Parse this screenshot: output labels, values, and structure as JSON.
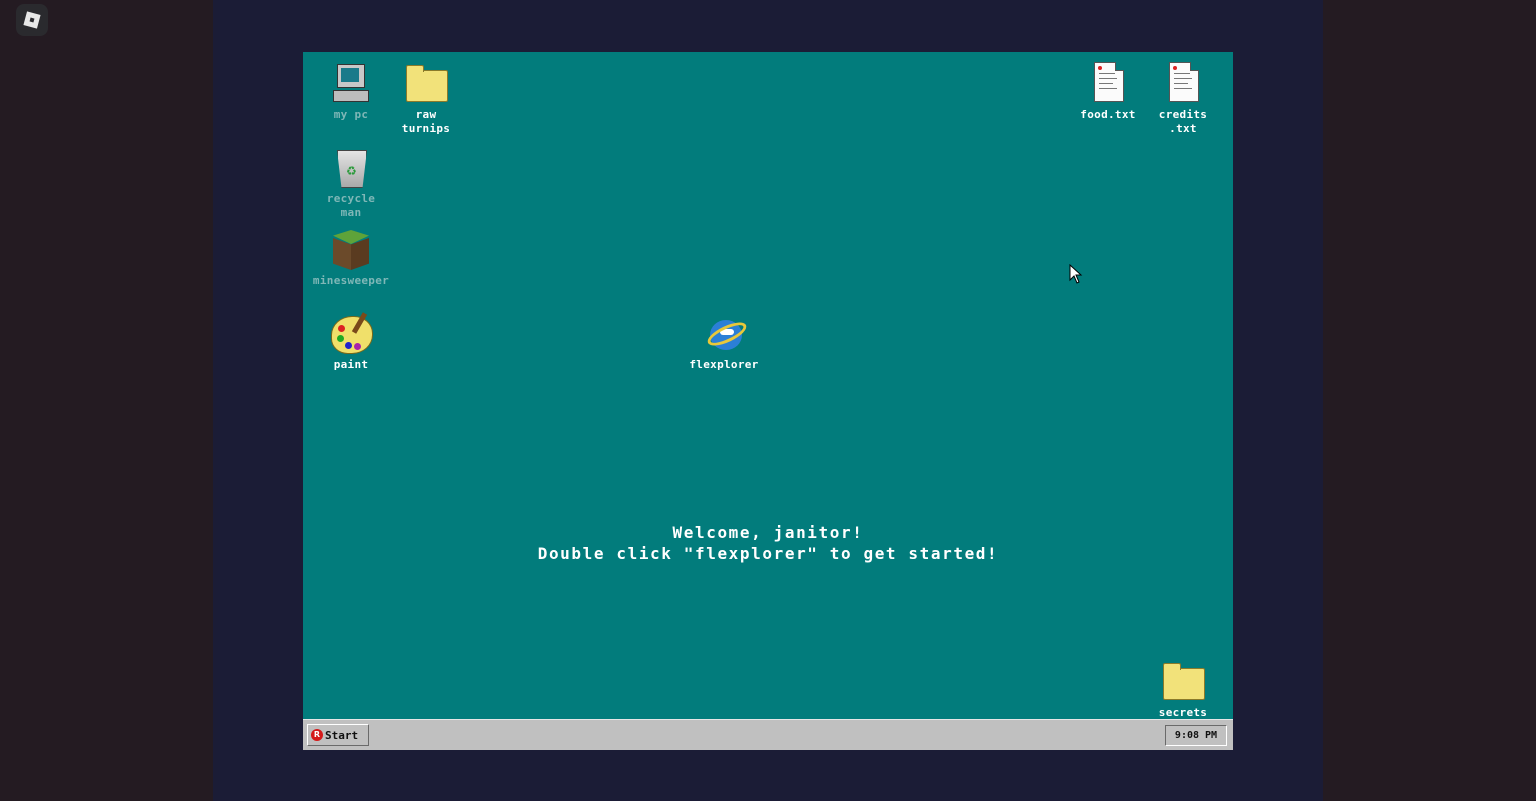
{
  "desktop": {
    "icons": [
      {
        "id": "my-pc",
        "label": "my pc",
        "icon": "computer-icon"
      },
      {
        "id": "raw-turnips",
        "label": "raw\nturnips",
        "icon": "folder-icon"
      },
      {
        "id": "recycle-man",
        "label": "recycle\nman",
        "icon": "recycle-bin-icon"
      },
      {
        "id": "minesweeper",
        "label": "minesweeper",
        "icon": "grass-block-icon"
      },
      {
        "id": "paint",
        "label": "paint",
        "icon": "palette-icon"
      },
      {
        "id": "flexplorer",
        "label": "flexplorer",
        "icon": "browser-icon"
      },
      {
        "id": "food-txt",
        "label": "food.txt",
        "icon": "text-file-icon"
      },
      {
        "id": "credits-txt",
        "label": "credits\n.txt",
        "icon": "text-file-icon"
      },
      {
        "id": "secrets",
        "label": "secrets",
        "icon": "folder-icon"
      }
    ],
    "welcome_line1": "Welcome, janitor!",
    "welcome_line2": "Double click \"flexplorer\" to get started!"
  },
  "taskbar": {
    "start_label": "Start",
    "start_logo": "R",
    "clock": "9:08 PM"
  },
  "colors": {
    "desktop_bg": "#027c7c",
    "taskbar_bg": "#c0c0c0",
    "outer_frame": "#1b1c36"
  }
}
